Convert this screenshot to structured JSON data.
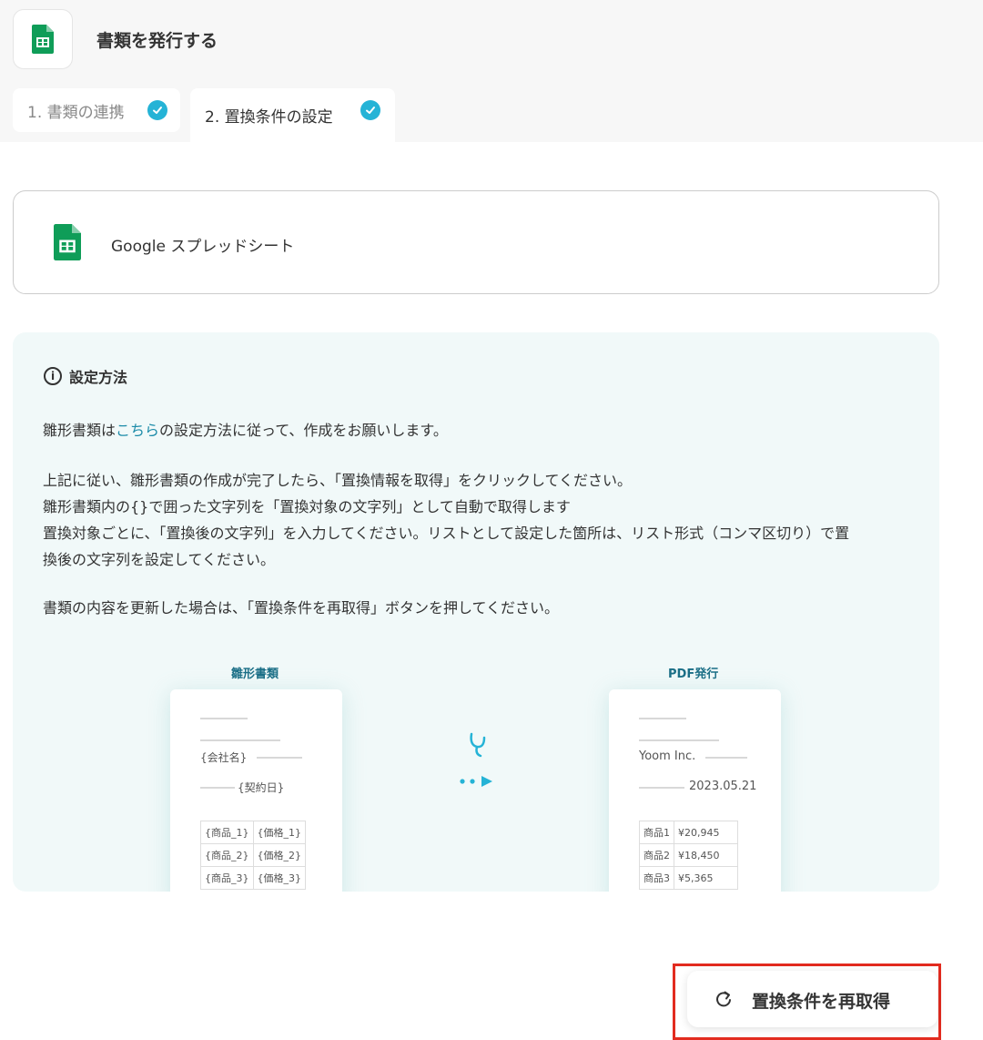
{
  "header": {
    "title": "書類を発行する"
  },
  "tabs": [
    {
      "label": "1. 書類の連携"
    },
    {
      "label": "2. 置換条件の設定"
    }
  ],
  "app": {
    "name": "Google スプレッドシート"
  },
  "info": {
    "heading": "設定方法",
    "p1_pre": "雛形書類は",
    "p1_link": "こちら",
    "p1_post": "の設定方法に従って、作成をお願いします。",
    "p2_lines": [
      "上記に従い、雛形書類の作成が完了したら、「置換情報を取得」をクリックしてください。",
      "雛形書類内の{}で囲った文字列を「置換対象の文字列」として自動で取得します",
      "置換対象ごとに、「置換後の文字列」を入力してください。リストとして設定した箇所は、リスト形式（コンマ区切り）で置",
      "換後の文字列を設定してください。"
    ],
    "p3": "書類の内容を更新した場合は、「置換条件を再取得」ボタンを押してください。"
  },
  "illustration": {
    "template_label": "雛形書類",
    "pdf_label": "PDF発行",
    "template": {
      "company": "{会社名}",
      "date": "{契約日}",
      "rows": [
        [
          "{商品_1}",
          "{価格_1}"
        ],
        [
          "{商品_2}",
          "{価格_2}"
        ],
        [
          "{商品_3}",
          "{価格_3}"
        ]
      ]
    },
    "pdf": {
      "company": "Yoom Inc.",
      "date": "2023.05.21",
      "rows": [
        [
          "商品1",
          "¥20,945"
        ],
        [
          "商品2",
          "¥18,450"
        ],
        [
          "商品3",
          "¥5,365"
        ]
      ]
    }
  },
  "action": {
    "label": "置換条件を再取得"
  },
  "colors": {
    "accent": "#25b3d6",
    "link": "#1d8ca9",
    "panel": "#f1f9f9",
    "highlight": "#e22b1f",
    "sheets_green": "#0f9d58"
  }
}
